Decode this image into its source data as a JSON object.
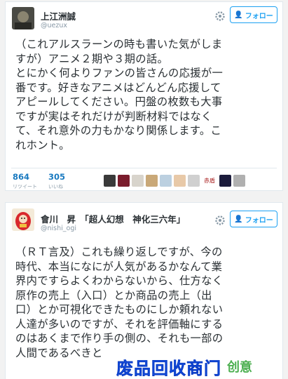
{
  "tweets": [
    {
      "author": "上江洲誠",
      "handle": "@uezux",
      "follow_label": "フォロー",
      "lines": [
        "（これアルスラーンの時も書いた気がしま",
        "すが）アニメ２期や３期の話。",
        "とにかく何よりファンの皆さんの応援が一",
        "番です。好きなアニメはどんどん応援して",
        "アピールしてください。円盤の枚数も大事",
        "ですが実はそれだけが判断材料ではなく",
        "て、それ意外の力もかなり関係します。こ",
        "れホント。"
      ],
      "retweets": "864",
      "retweets_label": "リツイート",
      "likes": "305",
      "likes_label": "いいね",
      "liker_colors": [
        "#3a3a3a",
        "#7a1c2c",
        "#d8d4cc",
        "#c9a878",
        "#bcd0e0",
        "#e8c9a8",
        "#d0d0d0",
        "#8a2a2a",
        "#1c1c3c",
        "#b0b0b0"
      ],
      "liker_text": "赤盾"
    },
    {
      "author": "會川　昇　「超人幻想　神化三六年」",
      "handle": "@nishi_ogi",
      "follow_label": "フォロー",
      "lines": [
        "（ＲＴ言及）これも繰り返しですが、今の",
        "時代、本当になにが人気があるかなんて業",
        "界内ですらよくわからないから、仕方なく",
        "原作の売上（入口）とか商品の売上（出",
        "口）とか可視化できたものにしか頼れない",
        "人達が多いのですが、それを評価軸にする",
        "のはあくまで作り手の側の、それも一部の",
        "人間であるべきと"
      ]
    }
  ],
  "watermark": {
    "main": "废品回收商门",
    "sub": "创意"
  },
  "colors": {
    "accent": "#1da1f2",
    "text": "#292f33",
    "muted": "#8899a6"
  }
}
